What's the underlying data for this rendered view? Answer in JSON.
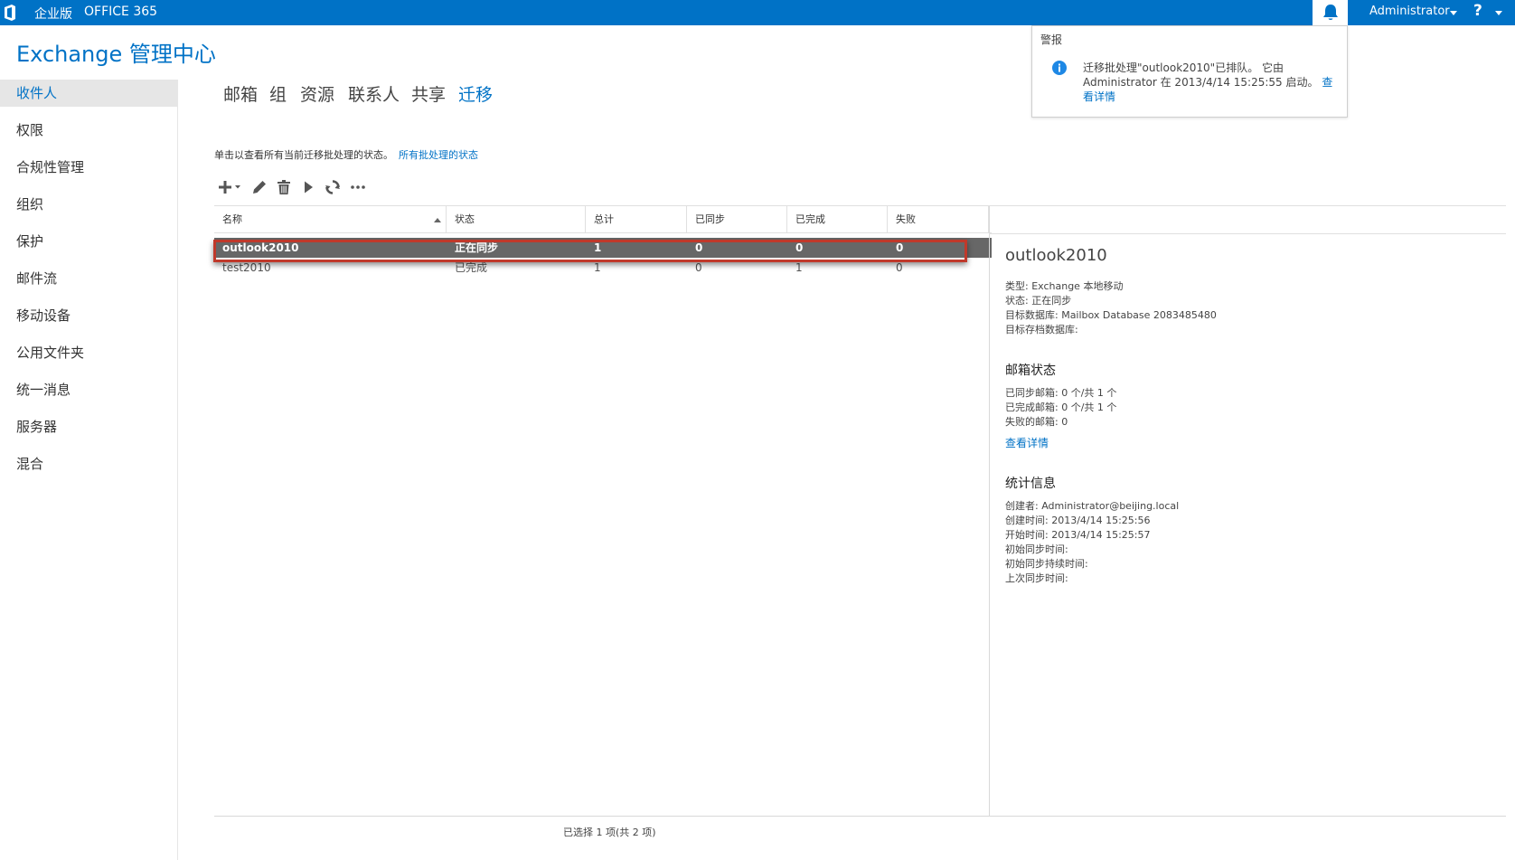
{
  "topbar": {
    "edition": "企业版",
    "suite": "OFFICE 365",
    "user": "Administrator",
    "help": "?"
  },
  "app": {
    "title": "Exchange 管理中心"
  },
  "sidebar": {
    "items": [
      {
        "label": "收件人",
        "active": true
      },
      {
        "label": "权限"
      },
      {
        "label": "合规性管理"
      },
      {
        "label": "组织"
      },
      {
        "label": "保护"
      },
      {
        "label": "邮件流"
      },
      {
        "label": "移动设备"
      },
      {
        "label": "公用文件夹"
      },
      {
        "label": "统一消息"
      },
      {
        "label": "服务器"
      },
      {
        "label": "混合"
      }
    ]
  },
  "tabs": [
    {
      "label": "邮箱"
    },
    {
      "label": "组"
    },
    {
      "label": "资源"
    },
    {
      "label": "联系人"
    },
    {
      "label": "共享"
    },
    {
      "label": "迁移",
      "active": true
    }
  ],
  "info": {
    "text": "单击以查看所有当前迁移批处理的状态。",
    "link": "所有批处理的状态"
  },
  "toolbar": {
    "icons": [
      "add-icon",
      "edit-icon",
      "delete-icon",
      "start-icon",
      "refresh-icon",
      "more-icon"
    ]
  },
  "grid": {
    "columns": [
      "名称",
      "状态",
      "总计",
      "已同步",
      "已完成",
      "失败"
    ],
    "rows": [
      [
        "outlook2010",
        "正在同步",
        "1",
        "0",
        "0",
        "0"
      ],
      [
        "test2010",
        "已完成",
        "1",
        "0",
        "1",
        "0"
      ]
    ],
    "status": "已选择 1 项(共 2 项)"
  },
  "details": {
    "title": "outlook2010",
    "general": [
      "类型: Exchange 本地移动",
      "状态: 正在同步",
      "目标数据库: Mailbox Database 2083485480",
      "目标存档数据库:"
    ],
    "mailbox_section": "邮箱状态",
    "mailbox": [
      "已同步邮箱: 0 个/共 1 个",
      "已完成邮箱: 0 个/共 1 个",
      "失败的邮箱: 0"
    ],
    "mailbox_link": "查看详情",
    "stats_section": "统计信息",
    "stats": [
      "创建者: Administrator@beijing.local",
      "创建时间: 2013/4/14 15:25:56",
      "开始时间: 2013/4/14 15:25:57",
      "初始同步时间:",
      "初始同步持续时间:",
      "上次同步时间:"
    ]
  },
  "notification": {
    "title": "警报",
    "message": "迁移批处理\"outlook2010\"已排队。 它由 Administrator 在 2013/4/14 15:25:55 启动。",
    "link": "查看详情"
  },
  "colors": {
    "brand": "#0072c6",
    "selected_row": "#676767",
    "highlight": "#c0392b"
  }
}
